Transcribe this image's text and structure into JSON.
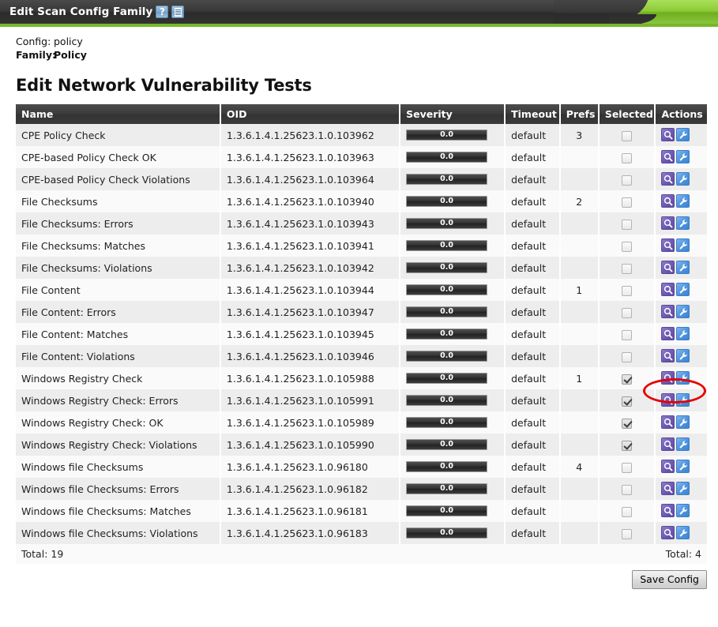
{
  "window": {
    "title": "Edit Scan Config Family",
    "help_icon": "help-icon",
    "list_icon": "list-icon"
  },
  "meta": {
    "config_label": "Config:",
    "config_value": "policy",
    "family_label": "Family:",
    "family_value": "Policy"
  },
  "page_title": "Edit Network Vulnerability Tests",
  "table": {
    "columns": [
      "Name",
      "OID",
      "Severity",
      "Timeout",
      "Prefs",
      "Selected",
      "Actions"
    ],
    "rows": [
      {
        "name": "CPE Policy Check",
        "oid": "1.3.6.1.4.1.25623.1.0.103962",
        "severity": "0.0",
        "timeout": "default",
        "prefs": "3",
        "selected": false
      },
      {
        "name": "CPE-based Policy Check OK",
        "oid": "1.3.6.1.4.1.25623.1.0.103963",
        "severity": "0.0",
        "timeout": "default",
        "prefs": "",
        "selected": false
      },
      {
        "name": "CPE-based Policy Check Violations",
        "oid": "1.3.6.1.4.1.25623.1.0.103964",
        "severity": "0.0",
        "timeout": "default",
        "prefs": "",
        "selected": false
      },
      {
        "name": "File Checksums",
        "oid": "1.3.6.1.4.1.25623.1.0.103940",
        "severity": "0.0",
        "timeout": "default",
        "prefs": "2",
        "selected": false
      },
      {
        "name": "File Checksums: Errors",
        "oid": "1.3.6.1.4.1.25623.1.0.103943",
        "severity": "0.0",
        "timeout": "default",
        "prefs": "",
        "selected": false
      },
      {
        "name": "File Checksums: Matches",
        "oid": "1.3.6.1.4.1.25623.1.0.103941",
        "severity": "0.0",
        "timeout": "default",
        "prefs": "",
        "selected": false
      },
      {
        "name": "File Checksums: Violations",
        "oid": "1.3.6.1.4.1.25623.1.0.103942",
        "severity": "0.0",
        "timeout": "default",
        "prefs": "",
        "selected": false
      },
      {
        "name": "File Content",
        "oid": "1.3.6.1.4.1.25623.1.0.103944",
        "severity": "0.0",
        "timeout": "default",
        "prefs": "1",
        "selected": false
      },
      {
        "name": "File Content: Errors",
        "oid": "1.3.6.1.4.1.25623.1.0.103947",
        "severity": "0.0",
        "timeout": "default",
        "prefs": "",
        "selected": false
      },
      {
        "name": "File Content: Matches",
        "oid": "1.3.6.1.4.1.25623.1.0.103945",
        "severity": "0.0",
        "timeout": "default",
        "prefs": "",
        "selected": false
      },
      {
        "name": "File Content: Violations",
        "oid": "1.3.6.1.4.1.25623.1.0.103946",
        "severity": "0.0",
        "timeout": "default",
        "prefs": "",
        "selected": false
      },
      {
        "name": "Windows Registry Check",
        "oid": "1.3.6.1.4.1.25623.1.0.105988",
        "severity": "0.0",
        "timeout": "default",
        "prefs": "1",
        "selected": true
      },
      {
        "name": "Windows Registry Check: Errors",
        "oid": "1.3.6.1.4.1.25623.1.0.105991",
        "severity": "0.0",
        "timeout": "default",
        "prefs": "",
        "selected": true
      },
      {
        "name": "Windows Registry Check: OK",
        "oid": "1.3.6.1.4.1.25623.1.0.105989",
        "severity": "0.0",
        "timeout": "default",
        "prefs": "",
        "selected": true
      },
      {
        "name": "Windows Registry Check: Violations",
        "oid": "1.3.6.1.4.1.25623.1.0.105990",
        "severity": "0.0",
        "timeout": "default",
        "prefs": "",
        "selected": true
      },
      {
        "name": "Windows file Checksums",
        "oid": "1.3.6.1.4.1.25623.1.0.96180",
        "severity": "0.0",
        "timeout": "default",
        "prefs": "4",
        "selected": false
      },
      {
        "name": "Windows file Checksums: Errors",
        "oid": "1.3.6.1.4.1.25623.1.0.96182",
        "severity": "0.0",
        "timeout": "default",
        "prefs": "",
        "selected": false
      },
      {
        "name": "Windows file Checksums: Matches",
        "oid": "1.3.6.1.4.1.25623.1.0.96181",
        "severity": "0.0",
        "timeout": "default",
        "prefs": "",
        "selected": false
      },
      {
        "name": "Windows file Checksums: Violations",
        "oid": "1.3.6.1.4.1.25623.1.0.96183",
        "severity": "0.0",
        "timeout": "default",
        "prefs": "",
        "selected": false
      }
    ],
    "totals": {
      "left": "Total: 19",
      "right": "Total: 4"
    }
  },
  "actions": {
    "details_icon": "magnifier-icon",
    "edit_icon": "wrench-icon"
  },
  "footer": {
    "save_label": "Save Config"
  },
  "annotation": {
    "shape": "red-ellipse",
    "color": "#e60000"
  },
  "colors": {
    "accent_green": "#76b82a",
    "titlebar_dark": "#333333",
    "row_odd": "#ededed",
    "row_even": "#fafafa",
    "magnifier": "#6f5cb5",
    "wrench": "#4f95e0"
  }
}
